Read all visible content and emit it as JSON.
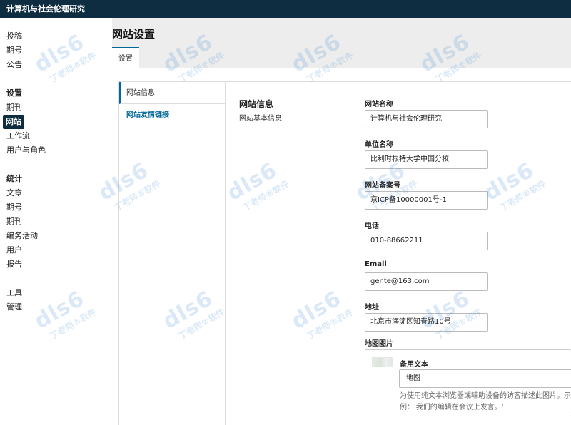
{
  "app": {
    "title": "计算机与社会伦理研究"
  },
  "sidebar": {
    "group1": [
      "投稿",
      "期号",
      "公告"
    ],
    "settings_heading": "设置",
    "settings_items": [
      "期刊",
      "网站",
      "工作流",
      "用户与角色"
    ],
    "active_item": "网站",
    "stats_heading": "统计",
    "stats_items": [
      "文章",
      "期号",
      "期刊",
      "编务活动",
      "用户",
      "报告"
    ],
    "tools_items": [
      "工具",
      "管理"
    ]
  },
  "page": {
    "title": "网站设置",
    "tab": "设置"
  },
  "subnav": {
    "items": [
      "网站信息",
      "网站友情链接"
    ]
  },
  "section": {
    "title": "网站信息",
    "description": "网站基本信息"
  },
  "fields": {
    "site_name": {
      "label": "网站名称",
      "value": "计算机与社会伦理研究"
    },
    "org_name": {
      "label": "单位名称",
      "value": "比利时根特大学中国分校"
    },
    "icp": {
      "label": "网站备案号",
      "value": "京ICP备10000001号-1"
    },
    "phone": {
      "label": "电话",
      "value": "010-88662211"
    },
    "email": {
      "label": "Email",
      "value": "gente@163.com"
    },
    "address": {
      "label": "地址",
      "value": "北京市海淀区知春路10号"
    },
    "map_image": {
      "label": "地图图片",
      "alt_label": "备用文本",
      "alt_value": "地图",
      "help": "为使用纯文本浏览器或辅助设备的访客描述此图片。示例：'我们的编辑在会议上发言。'"
    }
  },
  "watermark": {
    "brand": "dls",
    "brand_digit": "6",
    "tagline": "丁老师®软件"
  },
  "colors": {
    "topbar": "#0f2d40",
    "accent": "#006798",
    "background": "#ededed"
  }
}
